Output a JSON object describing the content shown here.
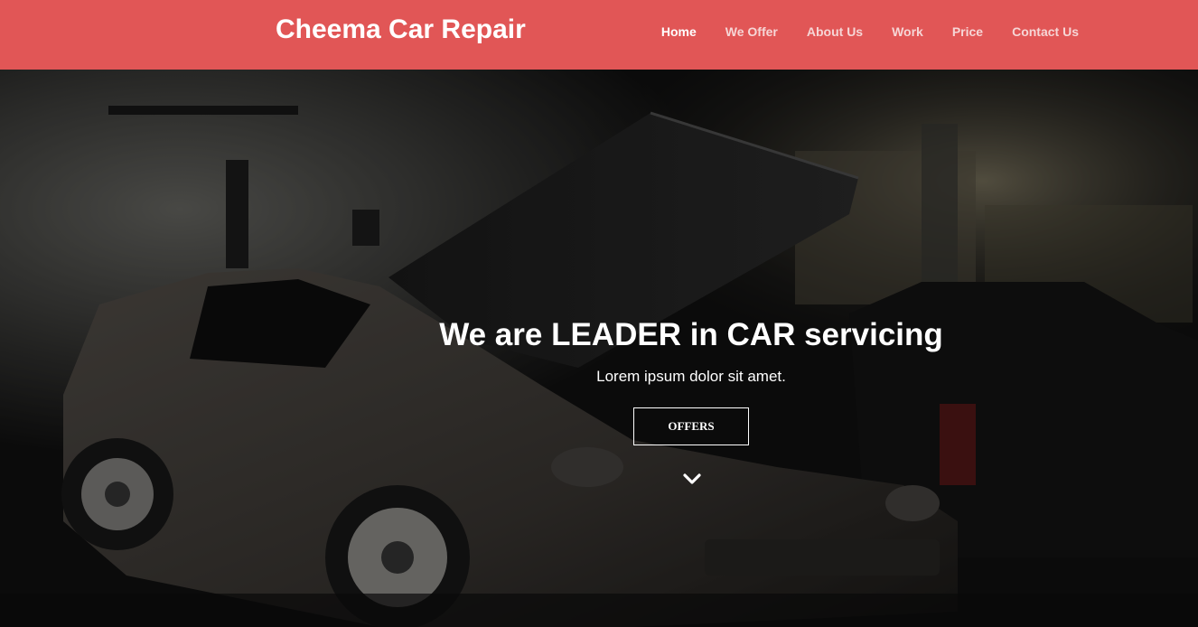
{
  "brand": {
    "title": "Cheema Car Repair"
  },
  "nav": {
    "items": [
      {
        "label": "Home",
        "active": true
      },
      {
        "label": "We Offer",
        "active": false
      },
      {
        "label": "About Us",
        "active": false
      },
      {
        "label": "Work",
        "active": false
      },
      {
        "label": "Price",
        "active": false
      },
      {
        "label": "Contact Us",
        "active": false
      }
    ]
  },
  "hero": {
    "title": "We are LEADER in CAR servicing",
    "subtitle": "Lorem ipsum dolor sit amet.",
    "button_label": "OFFERS",
    "scroll_icon": "chevron-down-icon"
  },
  "colors": {
    "navbar_bg": "#e15656",
    "text_primary": "#ffffff",
    "nav_inactive": "#f6d6d6"
  }
}
